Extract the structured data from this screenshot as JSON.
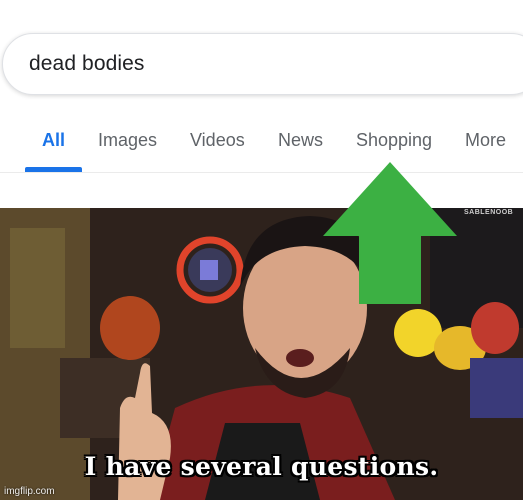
{
  "search": {
    "query": "dead bodies"
  },
  "tabs": [
    {
      "label": "All",
      "active": true
    },
    {
      "label": "Images",
      "active": false
    },
    {
      "label": "Videos",
      "active": false
    },
    {
      "label": "News",
      "active": false
    },
    {
      "label": "Shopping",
      "active": false
    },
    {
      "label": "More",
      "active": false
    }
  ],
  "colors": {
    "active_tab": "#1a73e8",
    "inactive_tab": "#5f6368",
    "arrow": "#3cb043"
  },
  "meme": {
    "caption": "I have several questions.",
    "channel_mark": "SABLENOOB",
    "watermark": "imgflip.com"
  },
  "icons": {
    "arrow": "up-arrow-icon"
  }
}
